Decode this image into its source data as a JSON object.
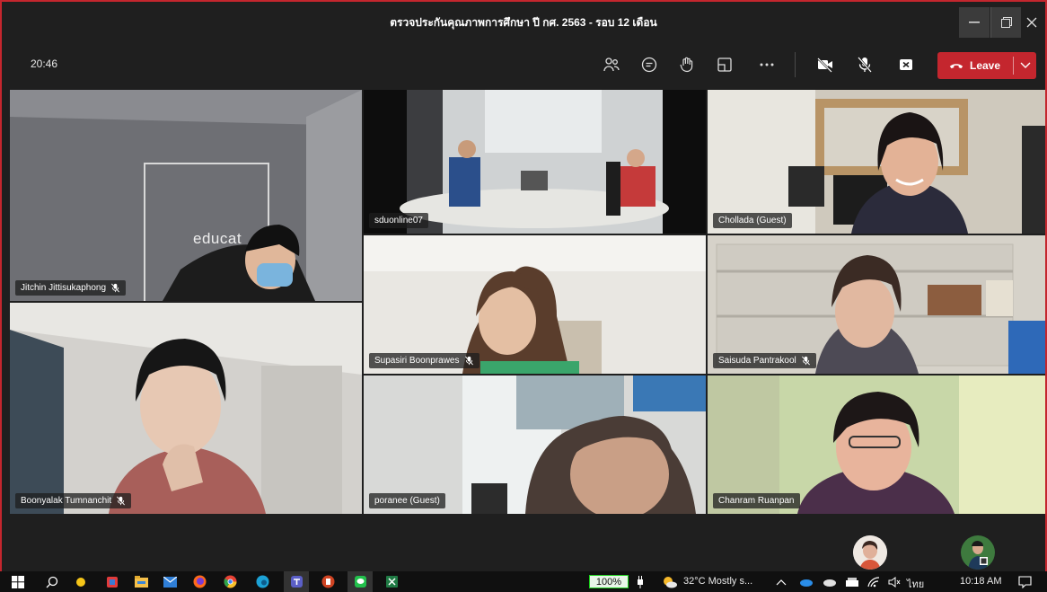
{
  "window": {
    "title": "ตรวจประกันคุณภาพการศึกษา ปี กศ. 2563 - รอบ 12 เดือน"
  },
  "toolbar": {
    "timer": "20:46",
    "icons": [
      "people-icon",
      "chat-icon",
      "raise-hand-icon",
      "rooms-icon",
      "more-icon",
      "camera-off-icon",
      "mic-off-icon",
      "share-icon"
    ],
    "leave_label": "Leave"
  },
  "participants": [
    {
      "name": "Jitchin Jittisukaphong",
      "muted": true
    },
    {
      "name": "sduonline07",
      "muted": false
    },
    {
      "name": "Chollada (Guest)",
      "muted": false
    },
    {
      "name": "Supasiri Boonprawes",
      "muted": true
    },
    {
      "name": "Saisuda Pantrakool",
      "muted": true
    },
    {
      "name": "Boonyalak Tumnanchit",
      "muted": true
    },
    {
      "name": "poranee (Guest)",
      "muted": false
    },
    {
      "name": "Chanram Ruanpan",
      "muted": false
    }
  ],
  "room_sign": "educat",
  "taskbar": {
    "battery": "100%",
    "weather": "32°C  Mostly s...",
    "language": "ไทย",
    "time": "10:18 AM"
  },
  "colors": {
    "accent": "#c4262e",
    "window_bg": "#1f1f1f"
  }
}
